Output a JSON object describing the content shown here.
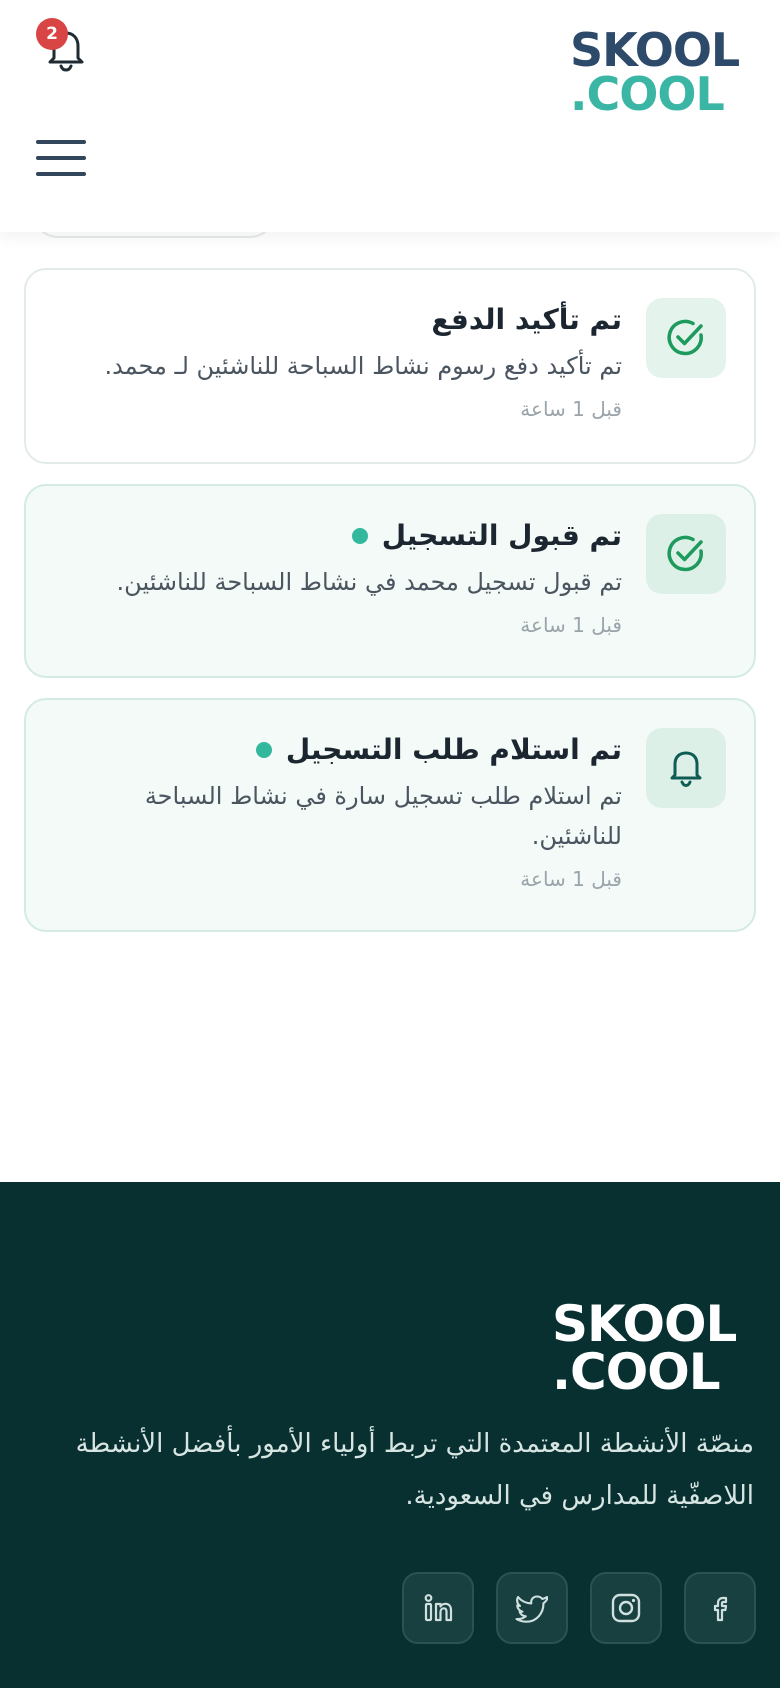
{
  "header": {
    "logo_line1": "SKOOL",
    "logo_line2": ".COOL",
    "notification_count": "2"
  },
  "notifications": [
    {
      "title": "تم تأكيد الدفع",
      "description": "تم تأكيد دفع رسوم نشاط السباحة للناشئين لـ محمد.",
      "time": "قبل 1 ساعة",
      "icon": "check-circle-icon",
      "unread": false
    },
    {
      "title": "تم قبول التسجيل",
      "description": "تم قبول تسجيل محمد في نشاط السباحة للناشئين.",
      "time": "قبل 1 ساعة",
      "icon": "check-circle-icon",
      "unread": true
    },
    {
      "title": "تم استلام طلب التسجيل",
      "description": "تم استلام طلب تسجيل سارة في نشاط السباحة للناشئين.",
      "time": "قبل 1 ساعة",
      "icon": "bell-icon",
      "unread": true
    }
  ],
  "footer": {
    "logo_line1": "SKOOL",
    "logo_line2": ".COOL",
    "tagline": "منصّة الأنشطة المعتمدة التي تربط أولياء الأمور بأفضل الأنشطة اللاصفّية للمدارس في السعودية.",
    "social_icons": [
      "facebook-icon",
      "instagram-icon",
      "twitter-icon",
      "linkedin-icon"
    ]
  },
  "colors": {
    "brand_navy": "#2d4a6b",
    "brand_teal": "#3bb6a4",
    "footer_bg": "#083030",
    "badge_red": "#d94545",
    "unread_dot": "#34b89d"
  }
}
